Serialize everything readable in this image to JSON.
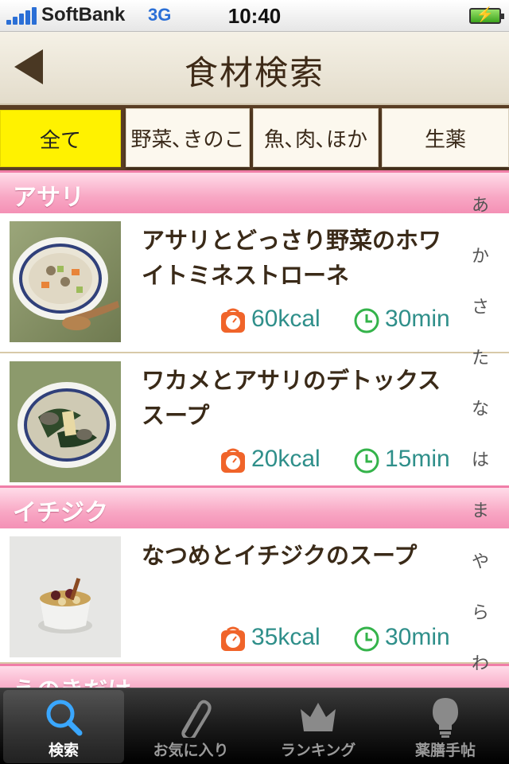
{
  "status_bar": {
    "carrier": "SoftBank",
    "network": "3G",
    "time": "10:40",
    "battery_symbol": "⚡",
    "signal_bars": 5
  },
  "nav": {
    "title": "食材検索",
    "back_icon": "back-arrow-icon"
  },
  "tabs": [
    {
      "label": "全て",
      "active": true
    },
    {
      "label": "野菜､きのこ",
      "active": false
    },
    {
      "label": "魚､肉､ほか",
      "active": false
    },
    {
      "label": "生薬",
      "active": false
    }
  ],
  "sections": [
    {
      "label": "アサリ"
    },
    {
      "label": "イチジク"
    },
    {
      "label": "えのきだけ"
    }
  ],
  "recipes": [
    {
      "title": "アサリとどっさり野菜のホワイトミネストローネ",
      "kcal": "60kcal",
      "time": "30min"
    },
    {
      "title": "ワカメとアサリのデトックススープ",
      "kcal": "20kcal",
      "time": "15min"
    },
    {
      "title": "なつめとイチジクのスープ",
      "kcal": "35kcal",
      "time": "30min"
    }
  ],
  "index": [
    "あ",
    "か",
    "さ",
    "た",
    "な",
    "は",
    "ま",
    "や",
    "ら",
    "わ"
  ],
  "tabbar": [
    {
      "label": "検索",
      "icon": "search-icon",
      "active": true
    },
    {
      "label": "お気に入り",
      "icon": "paperclip-icon",
      "active": false
    },
    {
      "label": "ランキング",
      "icon": "crown-icon",
      "active": false
    },
    {
      "label": "薬膳手帖",
      "icon": "lightbulb-icon",
      "active": false
    }
  ],
  "colors": {
    "accent_yellow": "#fff200",
    "section_pink": "#f490b5",
    "value_teal": "#2f8f8a",
    "kcal_orange": "#f0642a",
    "clock_green": "#34b34a",
    "title_brown": "#3a2a18"
  }
}
